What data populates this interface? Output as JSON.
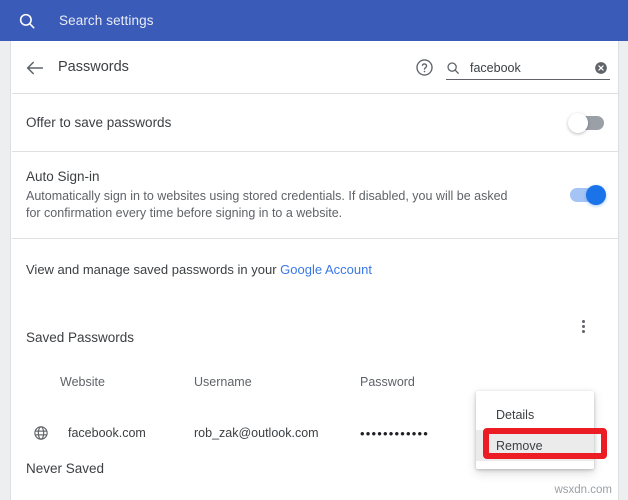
{
  "topbar": {
    "search_icon": "search-icon",
    "placeholder": "Search settings"
  },
  "subheader": {
    "back_icon": "back-arrow-icon",
    "title": "Passwords",
    "help_icon": "help-circle-icon",
    "search_icon": "search-icon",
    "search_value": "facebook",
    "clear_icon": "clear-circle-icon"
  },
  "settings": {
    "offer_to_save": {
      "label": "Offer to save passwords",
      "toggle_state": "off"
    },
    "auto_signin": {
      "label": "Auto Sign-in",
      "description": "Automatically sign in to websites using stored credentials. If disabled, you will be asked for confirmation every time before signing in to a website.",
      "toggle_state": "on"
    }
  },
  "account_line": {
    "text": "View and manage saved passwords in your ",
    "link_label": "Google Account"
  },
  "saved_passwords": {
    "section_title": "Saved Passwords",
    "more_icon": "three-dot-menu-icon",
    "columns": {
      "website": "Website",
      "username": "Username",
      "password": "Password"
    },
    "rows": [
      {
        "favicon": "globe-icon",
        "website": "facebook.com",
        "username": "rob_zak@outlook.com",
        "password_masked": "••••••••••••"
      }
    ]
  },
  "never_saved": {
    "title": "Never Saved"
  },
  "context_menu": {
    "items": [
      {
        "label": "Details",
        "highlighted": false
      },
      {
        "label": "Remove",
        "highlighted": true
      }
    ]
  },
  "annotation": {
    "highlight_target": "Remove",
    "color": "#ec1c24"
  },
  "watermark": {
    "text": "wsxdn.com"
  },
  "colors": {
    "topbar_blue": "#3a5bb8",
    "link_blue": "#3b78e7",
    "toggle_on": "#1a73e8",
    "toggle_off": "#9aa0a6",
    "text_primary": "#3c4043",
    "text_secondary": "#5f6368"
  }
}
